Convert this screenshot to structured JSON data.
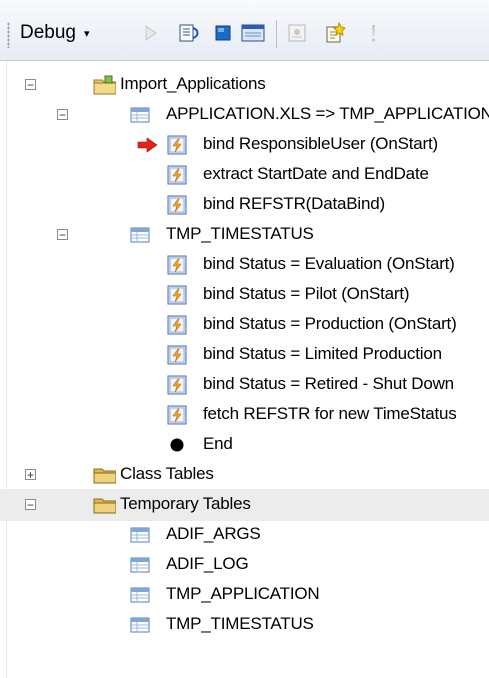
{
  "toolbar": {
    "debug_label": "Debug",
    "debug_arrow": "▾",
    "icons": [
      "run-icon",
      "step-into-icon",
      "stop-icon",
      "watch-window-icon",
      "properties-icon",
      "new-note-icon",
      "info-icon"
    ]
  },
  "tree": {
    "nodes": [
      {
        "label": "Import_Applications",
        "expander": "−",
        "icon": "package-folder-icon"
      },
      {
        "label": "APPLICATION.XLS => TMP_APPLICATION",
        "expander": "−",
        "icon": "table-icon"
      },
      {
        "label": "bind ResponsibleUser (OnStart)",
        "icon": "script-icon",
        "marker": "current-step-arrow"
      },
      {
        "label": "extract StartDate and EndDate",
        "icon": "script-icon"
      },
      {
        "label": "bind REFSTR(DataBind)",
        "icon": "script-icon"
      },
      {
        "label": "TMP_TIMESTATUS",
        "expander": "−",
        "icon": "table-icon"
      },
      {
        "label": "bind Status = Evaluation (OnStart)",
        "icon": "script-icon"
      },
      {
        "label": "bind Status = Pilot (OnStart)",
        "icon": "script-icon"
      },
      {
        "label": "bind Status = Production (OnStart)",
        "icon": "script-icon"
      },
      {
        "label": "bind Status = Limited Production",
        "icon": "script-icon"
      },
      {
        "label": "bind Status = Retired - Shut Down",
        "icon": "script-icon"
      },
      {
        "label": "fetch REFSTR for new TimeStatus",
        "icon": "script-icon"
      },
      {
        "label": "End",
        "icon": "end-dot-icon"
      },
      {
        "label": "Class Tables",
        "expander": "+",
        "icon": "folder-icon"
      },
      {
        "label": "Temporary Tables",
        "expander": "−",
        "icon": "folder-icon",
        "selected": true
      },
      {
        "label": "ADIF_ARGS",
        "icon": "table-icon"
      },
      {
        "label": "ADIF_LOG",
        "icon": "table-icon"
      },
      {
        "label": "TMP_APPLICATION",
        "icon": "table-icon"
      },
      {
        "label": "TMP_TIMESTATUS",
        "icon": "table-icon"
      }
    ]
  }
}
